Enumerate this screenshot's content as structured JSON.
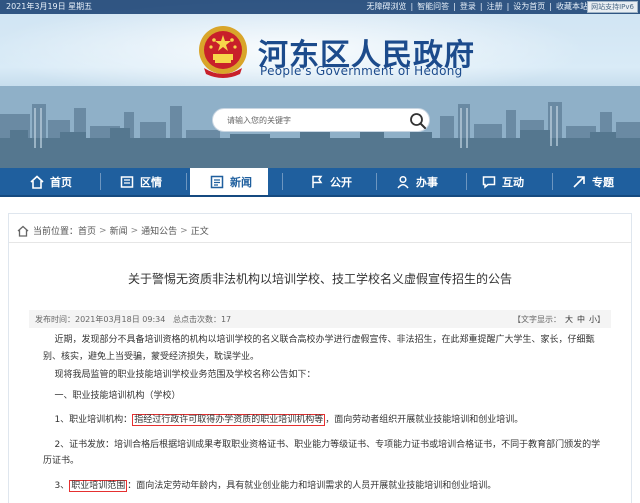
{
  "topbar": {
    "date": "2021年3月19日  星期五",
    "links": [
      "无障碍浏览",
      "|",
      "智能问答",
      "|",
      "登录",
      "|",
      "注册",
      "|",
      "设为首页",
      "|",
      "收藏本站"
    ],
    "ipv6": "网站支持IPv6"
  },
  "header": {
    "title": "河东区人民政府",
    "subtitle": "People's Government of Hedong"
  },
  "search": {
    "placeholder": "请输入您的关键字"
  },
  "nav": {
    "items": [
      {
        "label": "首页",
        "icon": "home-icon"
      },
      {
        "label": "区情",
        "icon": "map-icon"
      },
      {
        "label": "新闻",
        "icon": "news-icon"
      },
      {
        "label": "公开",
        "icon": "flag-icon"
      },
      {
        "label": "办事",
        "icon": "person-icon"
      },
      {
        "label": "互动",
        "icon": "chat-icon"
      },
      {
        "label": "专题",
        "icon": "topic-icon"
      }
    ],
    "active_index": 2
  },
  "breadcrumb": {
    "prefix": "当前位置：",
    "items": [
      "首页",
      "新闻",
      "通知公告",
      "正文"
    ],
    "separator": ">"
  },
  "article": {
    "title": "关于警惕无资质非法机构以培训学校、技工学校名义虚假宣传招生的公告",
    "publish_time": "发布时间：2021年03月18日 09:34",
    "views": "总点击次数：17",
    "font_size_label": "【文字显示：",
    "font_sizes": [
      "大",
      "中",
      "小"
    ],
    "font_size_end": "】",
    "paragraphs": {
      "p1a": "近期，发现部分不具备培训资格的机构以培训学校的名义联合高校办学进行虚假宣传、非法招生，在此郑重提醒广大学生、家长，仔细甄",
      "p1b": "别、核实，避免上当受骗，蒙受经济损失，耽误学业。",
      "p2": "现将我局监管的职业技能培训学校业务范围及学校名称公告如下：",
      "p3": "一、职业技能培训机构（学校）",
      "p4_pre": "1、职业培训机构：",
      "p4_hl": "指经过行政许可取得办学资质的职业培训机构等",
      "p4_post": "，面向劳动者组织开展就业技能培训和创业培训。",
      "p5a": "2、证书发放：培训合格后根据培训成果考取职业资格证书、职业能力等级证书、专项能力证书或培训合格证书，不同于教育部门颁发的学",
      "p5b": "历证书。",
      "p6_pre": "3、",
      "p6_hl": "职业培训范围",
      "p6_post": "：面向法定劳动年龄内，具有就业创业能力和培训需求的人员开展就业技能培训和创业培训。"
    }
  },
  "colors": {
    "nav_bg": "#1f5f9e",
    "title_blue": "#1c4b8c",
    "highlight_red": "#e53030"
  }
}
